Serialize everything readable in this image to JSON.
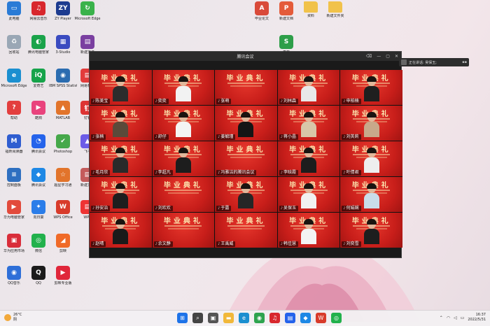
{
  "desktop": {
    "left_icons": [
      {
        "label": "此电脑",
        "icon": "monitor-icon",
        "color": "#2a7bd6",
        "glyph": "▭"
      },
      {
        "label": "网易云音乐",
        "icon": "netease-music-icon",
        "color": "#d8272d",
        "glyph": "♫"
      },
      {
        "label": "ZY Player",
        "icon": "zy-player-icon",
        "color": "#1d3b8f",
        "glyph": "ZY"
      },
      {
        "label": "Microsoft Edge",
        "icon": "edge-update-icon",
        "color": "#3ab24a",
        "glyph": "↻"
      },
      {
        "label": "回收站",
        "icon": "recycle-bin-icon",
        "color": "#9aa7b5",
        "glyph": "♻"
      },
      {
        "label": "腾讯电脑管家",
        "icon": "tencent-pc-manager-icon",
        "color": "#1aa34a",
        "glyph": "◐"
      },
      {
        "label": "3-Studio",
        "icon": "studio-icon",
        "color": "#3a4bc0",
        "glyph": "▦"
      },
      {
        "label": "新建文件",
        "icon": "winrar-icon",
        "color": "#7a3fa0",
        "glyph": "▤"
      },
      {
        "label": "Microsoft Edge",
        "icon": "edge-icon",
        "color": "#1b8fd0",
        "glyph": "e"
      },
      {
        "label": "爱奇艺",
        "icon": "iqiyi-icon",
        "color": "#16a34a",
        "glyph": "iQ"
      },
      {
        "label": "IBM SPSS Statistics 26",
        "icon": "spss-icon",
        "color": "#2b6cb0",
        "glyph": "◉"
      },
      {
        "label": "网易有道",
        "icon": "youdao-icon",
        "color": "#e23b3b",
        "glyph": "▤"
      },
      {
        "label": "帮助",
        "icon": "help-icon",
        "color": "#e33e3e",
        "glyph": "?"
      },
      {
        "label": "酷狗",
        "icon": "kugou-icon",
        "color": "#e9437d",
        "glyph": "▶"
      },
      {
        "label": "MATLAB",
        "icon": "matlab-icon",
        "color": "#e2742b",
        "glyph": "▲"
      },
      {
        "label": "钉钉",
        "icon": "zhihu-icon",
        "color": "#d33",
        "glyph": "钉"
      },
      {
        "label": "福昕阅读器",
        "icon": "foxit-icon",
        "color": "#2f5dd0",
        "glyph": "M"
      },
      {
        "label": "腾讯会议",
        "icon": "tencent-meeting-icon",
        "color": "#2563eb",
        "glyph": "◔"
      },
      {
        "label": "Photoshop",
        "icon": "check-app-icon",
        "color": "#46a84a",
        "glyph": "✔"
      },
      {
        "label": "飞书",
        "icon": "feishu-icon",
        "color": "#6c5ce7",
        "glyph": "▲"
      },
      {
        "label": "控制面板",
        "icon": "control-panel-icon",
        "color": "#2e6fc0",
        "glyph": "≡"
      },
      {
        "label": "腾讯会议",
        "icon": "meeting-app-icon",
        "color": "#1e88e5",
        "glyph": "◆"
      },
      {
        "label": "超星学习通",
        "icon": "chaoxing-icon",
        "color": "#e2742b",
        "glyph": "☆"
      },
      {
        "label": "新建文档",
        "icon": "document-icon",
        "color": "#c45b5b",
        "glyph": "▤"
      },
      {
        "label": "华为电脑管家",
        "icon": "huawei-icon",
        "color": "#e24a3b",
        "glyph": "▶"
      },
      {
        "label": "向日葵",
        "icon": "sunflower-icon",
        "color": "#2b7de9",
        "glyph": "✦"
      },
      {
        "label": "WPS Office",
        "icon": "wps-icon",
        "color": "#d83b2b",
        "glyph": "W"
      },
      {
        "label": "WPS",
        "icon": "wps-doc-icon",
        "color": "#e33",
        "glyph": "▤"
      },
      {
        "label": "华为应用市场",
        "icon": "huawei-store-icon",
        "color": "#d92d3a",
        "glyph": "▣"
      },
      {
        "label": "微信",
        "icon": "wechat-icon",
        "color": "#22b14c",
        "glyph": "◎"
      },
      {
        "label": "剪映",
        "icon": "capcut-icon",
        "color": "#f06a28",
        "glyph": "◢"
      },
      {
        "label": "QQ音乐",
        "icon": "qqmusic-icon",
        "color": "#2e6fd8",
        "glyph": "◉"
      },
      {
        "label": "QQ",
        "icon": "qq-icon",
        "color": "#1b1b1b",
        "glyph": "Q"
      },
      {
        "label": "剪映专业版",
        "icon": "jianying-icon",
        "color": "#e0263a",
        "glyph": "▶"
      }
    ],
    "top_icons": [
      {
        "label": "毕业论文",
        "icon": "pdf-file-icon",
        "color": "#d94a3a",
        "glyph": "A"
      },
      {
        "label": "新建文档",
        "icon": "word-file-icon",
        "color": "#e45b3a",
        "glyph": "P"
      },
      {
        "label": "资料",
        "icon": "folder-icon",
        "color": "#f1c24a",
        "glyph": ""
      },
      {
        "label": "新建文件夹",
        "icon": "folder-icon",
        "color": "#f1c24a",
        "glyph": ""
      },
      {
        "label": "表格",
        "icon": "excel-file-icon",
        "color": "#2e9e49",
        "glyph": "S"
      }
    ]
  },
  "meeting": {
    "title": "腾讯会议",
    "controls": [
      "⌫",
      "—",
      "▢",
      "✕"
    ],
    "banner": "毕业典礼",
    "participants": [
      {
        "name": "陈美宝",
        "shirt": "#2c2c2c",
        "person": true
      },
      {
        "name": "奕奕",
        "shirt": "#f2f2f2",
        "person": true
      },
      {
        "name": "张萌",
        "shirt": "#ffffff",
        "person": false
      },
      {
        "name": "刘林森",
        "shirt": "#e8e8e8",
        "person": true
      },
      {
        "name": "申柏楠",
        "shirt": "#1f1f1f",
        "person": true
      },
      {
        "name": "张楠",
        "shirt": "#5b4a3a",
        "person": true
      },
      {
        "name": "舒仔",
        "shirt": "#f4f4f4",
        "person": true
      },
      {
        "name": "姜毓瑾",
        "shirt": "#151515",
        "person": true
      },
      {
        "name": "蒋小晶",
        "shirt": "#d8c6a8",
        "person": true
      },
      {
        "name": "刘英莉",
        "shirt": "#c8a88a",
        "person": true
      },
      {
        "name": "毛月欣",
        "shirt": "#2a2a2a",
        "person": true
      },
      {
        "name": "李超凡",
        "shirt": "#1d1d1d",
        "person": true
      },
      {
        "name": "冯雅洁的腾讯会议",
        "shirt": "#333",
        "person": false
      },
      {
        "name": "李晗霞",
        "shirt": "#1d1d1d",
        "person": true
      },
      {
        "name": "叶倩君",
        "shirt": "#eee",
        "person": true
      },
      {
        "name": "孙安治",
        "shirt": "#1e1e1e",
        "person": true
      },
      {
        "name": "刘欢欢",
        "shirt": "#d43a2f",
        "person": false
      },
      {
        "name": "于露",
        "shirt": "#262626",
        "person": true
      },
      {
        "name": "吴保玉",
        "shirt": "#f1f1f1",
        "person": true
      },
      {
        "name": "何娟娴",
        "shirt": "#c9dde9",
        "person": true
      },
      {
        "name": "赵晴",
        "shirt": "#1a1a1a",
        "person": true
      },
      {
        "name": "余文静",
        "shirt": "#d43a2f",
        "person": false
      },
      {
        "name": "王禹威",
        "shirt": "#d43a2f",
        "person": false
      },
      {
        "name": "韩佳慧",
        "shirt": "#f3f3f3",
        "person": true
      },
      {
        "name": "刘奕雪",
        "shirt": "#1e1e1e",
        "person": true
      }
    ]
  },
  "speaker": {
    "label": "正在讲话: 吴保玉;"
  },
  "taskbar": {
    "weather_temp": "26°C",
    "weather_desc": "阴",
    "apps": [
      {
        "icon": "start-icon",
        "color": "#1e73e8",
        "glyph": "⊞"
      },
      {
        "icon": "search-icon",
        "color": "#444",
        "glyph": "⌕"
      },
      {
        "icon": "task-view-icon",
        "color": "#555",
        "glyph": "▣"
      },
      {
        "icon": "explorer-icon",
        "color": "#f1b83a",
        "glyph": "▬"
      },
      {
        "icon": "edge-icon",
        "color": "#1b8fd0",
        "glyph": "e"
      },
      {
        "icon": "chrome-icon",
        "color": "#2ea44f",
        "glyph": "◉"
      },
      {
        "icon": "music-icon",
        "color": "#d8272d",
        "glyph": "♫"
      },
      {
        "icon": "folder-icon",
        "color": "#2563eb",
        "glyph": "▤"
      },
      {
        "icon": "meeting-icon",
        "color": "#1e88e5",
        "glyph": "◆"
      },
      {
        "icon": "wps-icon",
        "color": "#d83b2b",
        "glyph": "W"
      },
      {
        "icon": "wechat-icon",
        "color": "#22b14c",
        "glyph": "◎"
      }
    ],
    "time": "16:37",
    "date": "2022/5/31"
  }
}
